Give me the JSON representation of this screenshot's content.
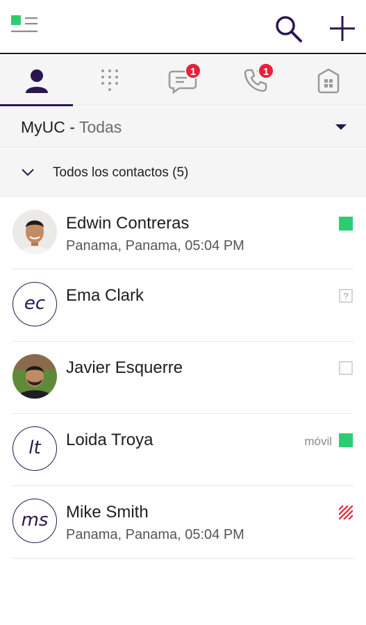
{
  "header": {
    "menu_icon": "menu-icon",
    "search_icon": "search-icon",
    "add_icon": "plus-icon"
  },
  "tabs": [
    {
      "name": "contacts",
      "icon": "person-icon",
      "active": true,
      "badge": ""
    },
    {
      "name": "dialpad",
      "icon": "dialpad-icon",
      "active": false,
      "badge": ""
    },
    {
      "name": "chat",
      "icon": "chat-bubble-icon",
      "active": false,
      "badge": "1"
    },
    {
      "name": "calls",
      "icon": "phone-icon",
      "active": false,
      "badge": "1"
    },
    {
      "name": "directory",
      "icon": "building-icon",
      "active": false,
      "badge": ""
    }
  ],
  "filter": {
    "prefix": "MyUC -",
    "value": "Todas"
  },
  "group": {
    "label": "Todos los contactos (5)"
  },
  "contacts": [
    {
      "name": "Edwin Contreras",
      "location": "Panama, Panama, 05:04 PM",
      "avatar": "photo",
      "initials": "",
      "device": "",
      "presence": "available"
    },
    {
      "name": "Ema Clark",
      "location": "",
      "avatar": "initials",
      "initials": "ec",
      "device": "",
      "presence": "unknown"
    },
    {
      "name": "Javier Esquerre",
      "location": "",
      "avatar": "photo",
      "initials": "",
      "device": "",
      "presence": "offline"
    },
    {
      "name": "Loida Troya",
      "location": "",
      "avatar": "initials",
      "initials": "lt",
      "device": "móvil",
      "presence": "available"
    },
    {
      "name": "Mike Smith",
      "location": "Panama, Panama, 05:04 PM",
      "avatar": "initials",
      "initials": "ms",
      "device": "",
      "presence": "busy"
    }
  ],
  "colors": {
    "accent": "#2b1650",
    "available": "#2ecc71",
    "busy": "#e8203a",
    "badge": "#e8203a",
    "surface": "#f5f5f6"
  }
}
